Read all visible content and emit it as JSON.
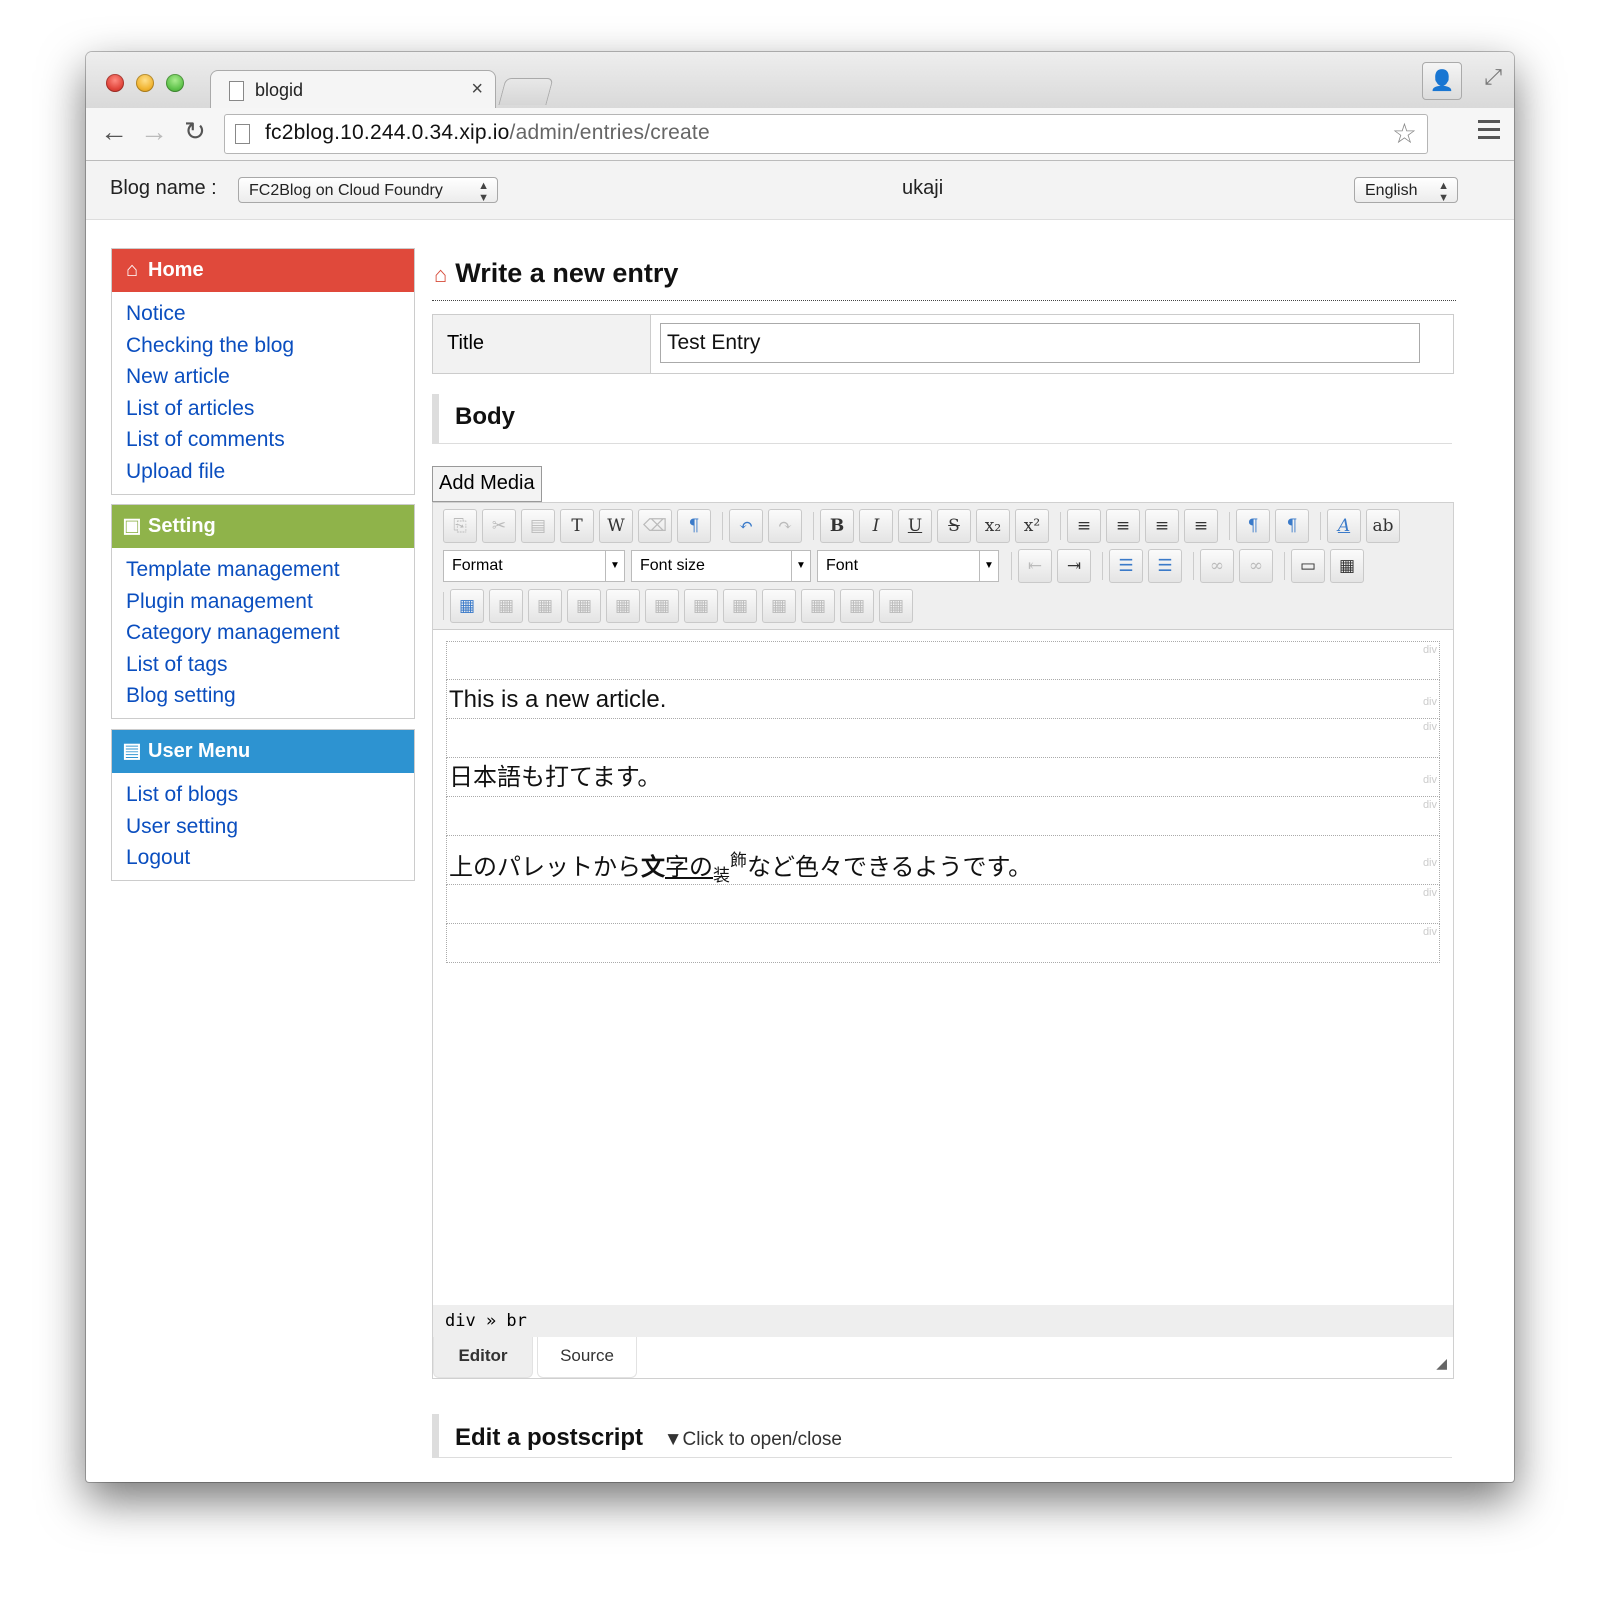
{
  "browser": {
    "tab_title": "blogid",
    "tab_close": "×",
    "url_host": "fc2blog.10.244.0.34.xip.io",
    "url_path": "/admin/entries/create",
    "back": "←",
    "forward": "→",
    "reload": "↻",
    "star": "☆",
    "profile": "👤",
    "fullscreen": "⤢"
  },
  "blogbar": {
    "label": "Blog name :",
    "blog_select": "FC2Blog on Cloud Foundry",
    "user": "ukaji",
    "language_select": "English"
  },
  "sidebar": {
    "home": {
      "title": "Home",
      "color": "#e0493b",
      "items": [
        "Notice",
        "Checking the blog",
        "New article",
        "List of articles",
        "List of comments",
        "Upload file"
      ]
    },
    "setting": {
      "title": "Setting",
      "color": "#8fb34a",
      "items": [
        "Template management",
        "Plugin management",
        "Category management",
        "List of tags",
        "Blog setting"
      ]
    },
    "user_menu": {
      "title": "User Menu",
      "color": "#2d93d1",
      "items": [
        "List of blogs",
        "User setting",
        "Logout"
      ]
    }
  },
  "main": {
    "heading": "Write a new entry",
    "title_label": "Title",
    "title_value": "Test Entry",
    "body_label": "Body",
    "add_media": "Add Media",
    "format_combo": "Format",
    "font_size_combo": "Font size",
    "font_combo": "Font",
    "content": {
      "line1": "This is a new article.",
      "line2": "日本語も打てます。",
      "line3_a": "上のパレットから",
      "line3_bold": "文",
      "line3_under": "字の",
      "line3_sub": "装",
      "line3_sup": "飾",
      "line3_b": "など色々できるようです。",
      "block_tag": "div"
    },
    "path": "div » br",
    "tab_editor": "Editor",
    "tab_source": "Source",
    "postscript_label": "Edit a postscript",
    "postscript_toggle": "▼Click to open/close"
  }
}
